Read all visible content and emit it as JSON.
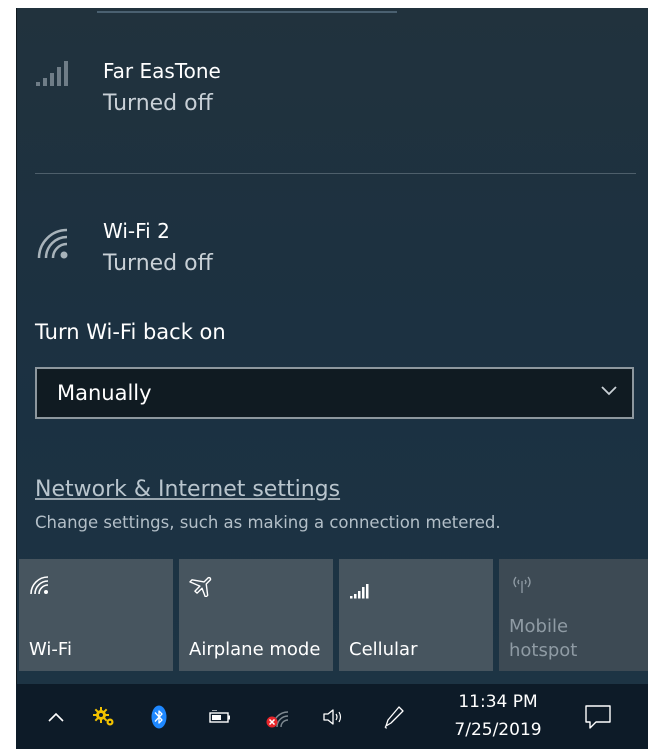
{
  "networks": [
    {
      "name": "Far EasTone",
      "status": "Turned off",
      "icon": "cellular-signal-icon"
    },
    {
      "name": "Wi-Fi 2",
      "status": "Turned off",
      "icon": "wifi-signal-icon"
    }
  ],
  "wifi_back_on": {
    "label": "Turn Wi-Fi back on",
    "selected": "Manually"
  },
  "settings": {
    "link": "Network & Internet settings",
    "description": "Change settings, such as making a connection metered."
  },
  "quick_actions": [
    {
      "label": "Wi-Fi",
      "icon": "wifi-icon",
      "enabled": true
    },
    {
      "label": "Airplane mode",
      "icon": "airplane-icon",
      "enabled": true
    },
    {
      "label": "Cellular",
      "icon": "cellular-icon",
      "enabled": true
    },
    {
      "label_line1": "Mobile",
      "label_line2": "hotspot",
      "icon": "mobile-hotspot-icon",
      "enabled": false
    }
  ],
  "taskbar": {
    "time": "11:34 PM",
    "date": "7/25/2019",
    "icons": [
      "chevron-up-icon",
      "settings-gear-icon",
      "bluetooth-icon",
      "battery-icon",
      "wifi-disconnected-icon",
      "volume-icon",
      "pen-icon",
      "action-center-icon"
    ]
  },
  "colors": {
    "flyout_bg": "#1d3140",
    "tile_bg": "#47555f",
    "taskbar_bg": "#0d1b28",
    "bluetooth_blue": "#1e88ff",
    "gear_yellow": "#f2c200",
    "error_red": "#e8262b"
  }
}
